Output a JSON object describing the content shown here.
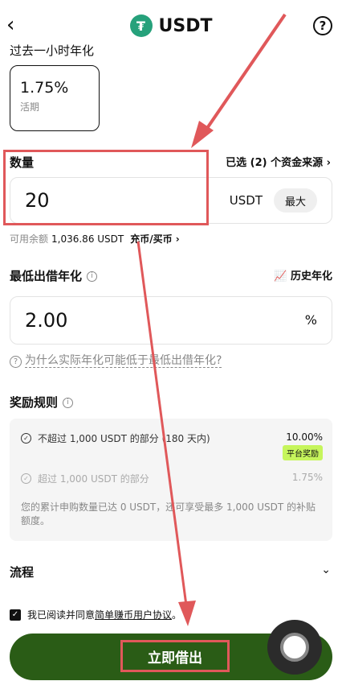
{
  "header": {
    "back": "‹",
    "logo": "₮",
    "title": "USDT",
    "help": "?"
  },
  "apr": {
    "label": "过去一小时年化",
    "rate": "1.75%",
    "type": "活期"
  },
  "quantity": {
    "label": "数量",
    "sources": "已选 (2) 个资金来源  ›",
    "value": "20",
    "unit": "USDT",
    "max": "最大"
  },
  "balance": {
    "label": "可用余额",
    "amount": "1,036.86 USDT",
    "deposit": "充币/买币 ›"
  },
  "min_rate": {
    "label": "最低出借年化",
    "history": "历史年化",
    "value": "2.00",
    "unit": "%",
    "why": "为什么实际年化可能低于最低出借年化?"
  },
  "rewards": {
    "label": "奖励规则",
    "tier1": "不超过 1,000 USDT 的部分 (180 天内)",
    "tier1_rate": "10.00%",
    "badge": "平台奖励",
    "tier2": "超过 1,000 USDT 的部分",
    "tier2_rate": "1.75%",
    "note": "您的累计申购数量已达 0 USDT，还可享受最多 1,000 USDT 的补贴额度。"
  },
  "flow": {
    "label": "流程",
    "chevron": "⌄"
  },
  "agreement": {
    "prefix": "我已阅读并同意",
    "link": "简单赚币用户协议",
    "suffix": "。"
  },
  "action": {
    "borrow": "立即借出"
  },
  "colors": {
    "brand": "#26a17b",
    "button": "#2a5c16",
    "annotation": "#e0585a",
    "badge": "#c6f55c"
  },
  "icons": [
    "back-icon",
    "usdt-logo-icon",
    "help-icon",
    "info-icon",
    "chart-icon",
    "checkmark-icon",
    "chevron-down-icon"
  ]
}
